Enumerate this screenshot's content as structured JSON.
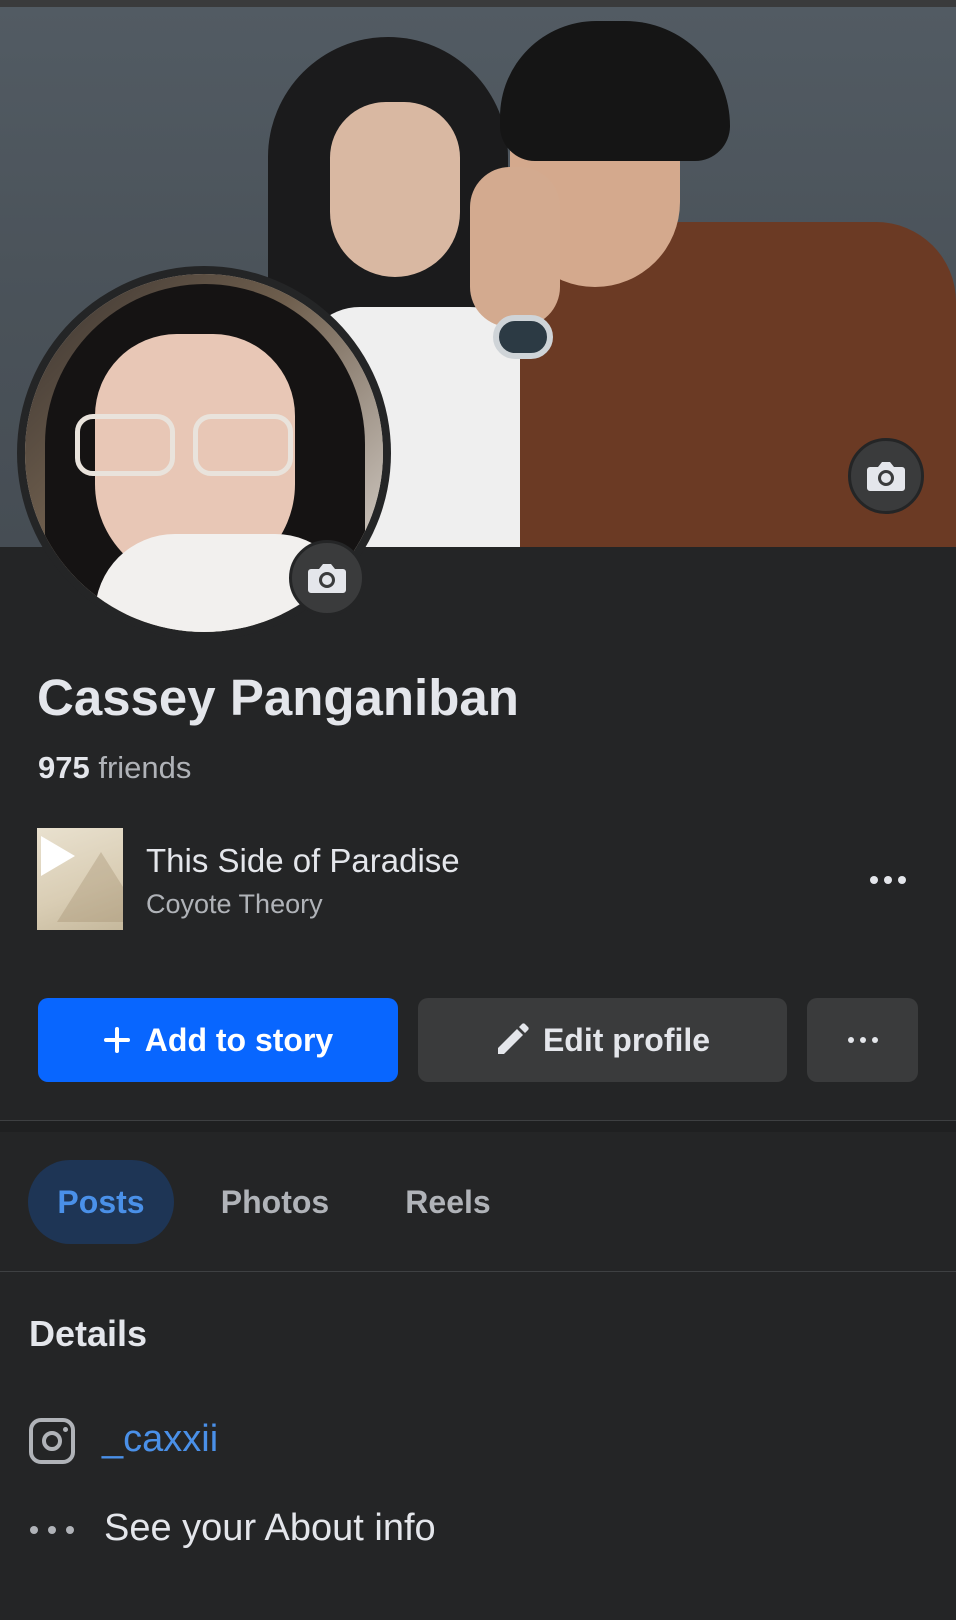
{
  "profile": {
    "name": "Cassey Panganiban",
    "friends_count": "975",
    "friends_label": "friends"
  },
  "music": {
    "song_title": "This Side of Paradise",
    "artist": "Coyote Theory"
  },
  "actions": {
    "add_to_story_label": "Add to story",
    "edit_profile_label": "Edit profile"
  },
  "tabs": [
    {
      "label": "Posts",
      "active": true
    },
    {
      "label": "Photos",
      "active": false
    },
    {
      "label": "Reels",
      "active": false
    }
  ],
  "details": {
    "title": "Details",
    "instagram_handle": "_caxxii",
    "about_label": "See your About info"
  },
  "icons": {
    "cover_camera": "camera-icon",
    "avatar_camera": "camera-icon",
    "music_play": "play-icon",
    "music_more": "more-horizontal-icon",
    "add": "plus-icon",
    "edit": "pencil-icon",
    "more": "more-horizontal-icon",
    "instagram": "instagram-icon",
    "about": "more-horizontal-icon"
  },
  "colors": {
    "background": "#242526",
    "primary_button": "#0866ff",
    "secondary_button": "#3a3b3c",
    "active_tab_bg": "#1e3555",
    "link": "#4a90e8"
  }
}
